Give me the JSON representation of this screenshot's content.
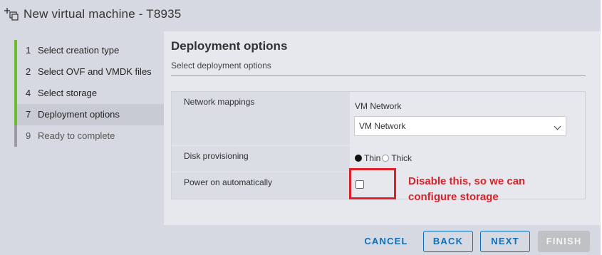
{
  "window": {
    "title": "New virtual machine - T8935"
  },
  "steps": [
    {
      "num": "1",
      "label": "Select creation type",
      "state": "done"
    },
    {
      "num": "2",
      "label": "Select OVF and VMDK files",
      "state": "done"
    },
    {
      "num": "4",
      "label": "Select storage",
      "state": "done"
    },
    {
      "num": "7",
      "label": "Deployment options",
      "state": "active"
    },
    {
      "num": "9",
      "label": "Ready to complete",
      "state": "pending"
    }
  ],
  "page": {
    "heading": "Deployment options",
    "subheading": "Select deployment options"
  },
  "network": {
    "label": "Network mappings",
    "vm_network_label": "VM Network",
    "selected": "VM Network"
  },
  "disk": {
    "label": "Disk provisioning",
    "options": [
      "Thin",
      "Thick"
    ],
    "selected": "Thin"
  },
  "power": {
    "label": "Power on automatically",
    "checked": false
  },
  "annotation": {
    "text_line1": "Disable this, so we can",
    "text_line2": "configure storage",
    "color": "#e0212a"
  },
  "footer": {
    "cancel": "CANCEL",
    "back": "BACK",
    "next": "NEXT",
    "finish": "FINISH"
  },
  "colors": {
    "accent": "#0d6fb8",
    "step_done": "#6fbc2f",
    "step_pending": "#9a9ca2"
  }
}
